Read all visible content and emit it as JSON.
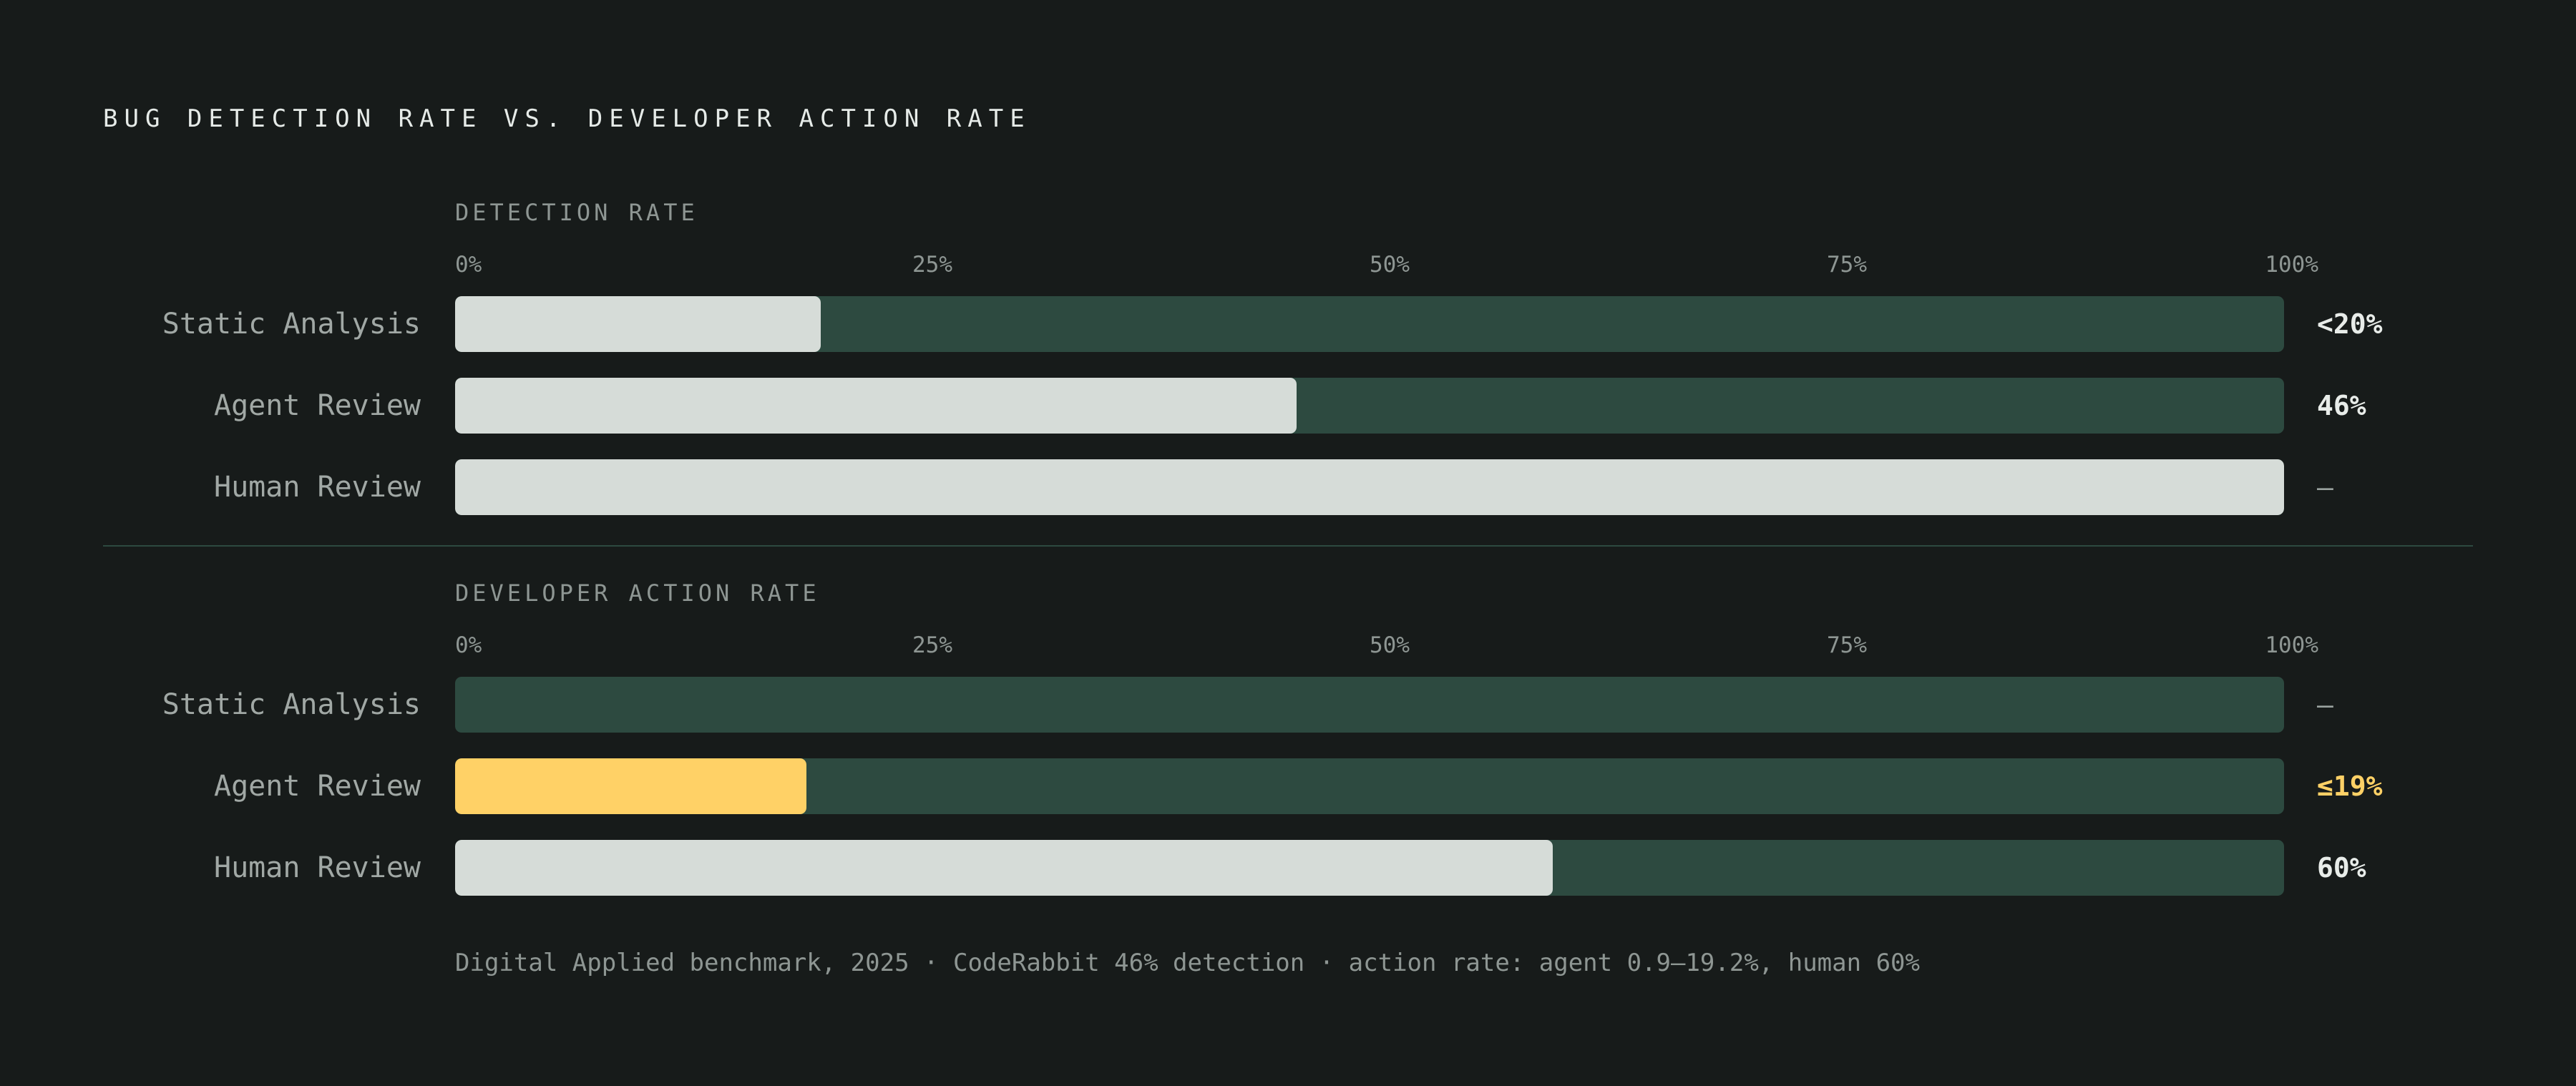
{
  "title": "BUG DETECTION RATE VS. DEVELOPER ACTION RATE",
  "colors": {
    "background": "#171b1a",
    "track": "#2d4a40",
    "fill": "#d6dcd8",
    "accent": "#ffd166",
    "muted_text": "#8e9693"
  },
  "chart_data": [
    {
      "type": "bar",
      "orientation": "horizontal",
      "title": "DETECTION RATE",
      "xlim": [
        0,
        100
      ],
      "x_ticks": [
        "0%",
        "25%",
        "50%",
        "75%",
        "100%"
      ],
      "categories": [
        "Static Analysis",
        "Agent Review",
        "Human Review"
      ],
      "values": [
        20,
        46,
        100
      ],
      "value_labels": [
        "<20%",
        "46%",
        "—"
      ],
      "highlight": [
        false,
        false,
        false
      ]
    },
    {
      "type": "bar",
      "orientation": "horizontal",
      "title": "DEVELOPER ACTION RATE",
      "xlim": [
        0,
        100
      ],
      "x_ticks": [
        "0%",
        "25%",
        "50%",
        "75%",
        "100%"
      ],
      "categories": [
        "Static Analysis",
        "Agent Review",
        "Human Review"
      ],
      "values": [
        0,
        19.2,
        60
      ],
      "value_labels": [
        "—",
        "≤19%",
        "60%"
      ],
      "highlight": [
        false,
        true,
        false
      ]
    }
  ],
  "footnote": "Digital Applied benchmark, 2025 · CodeRabbit 46% detection · action rate: agent 0.9–19.2%, human 60%"
}
